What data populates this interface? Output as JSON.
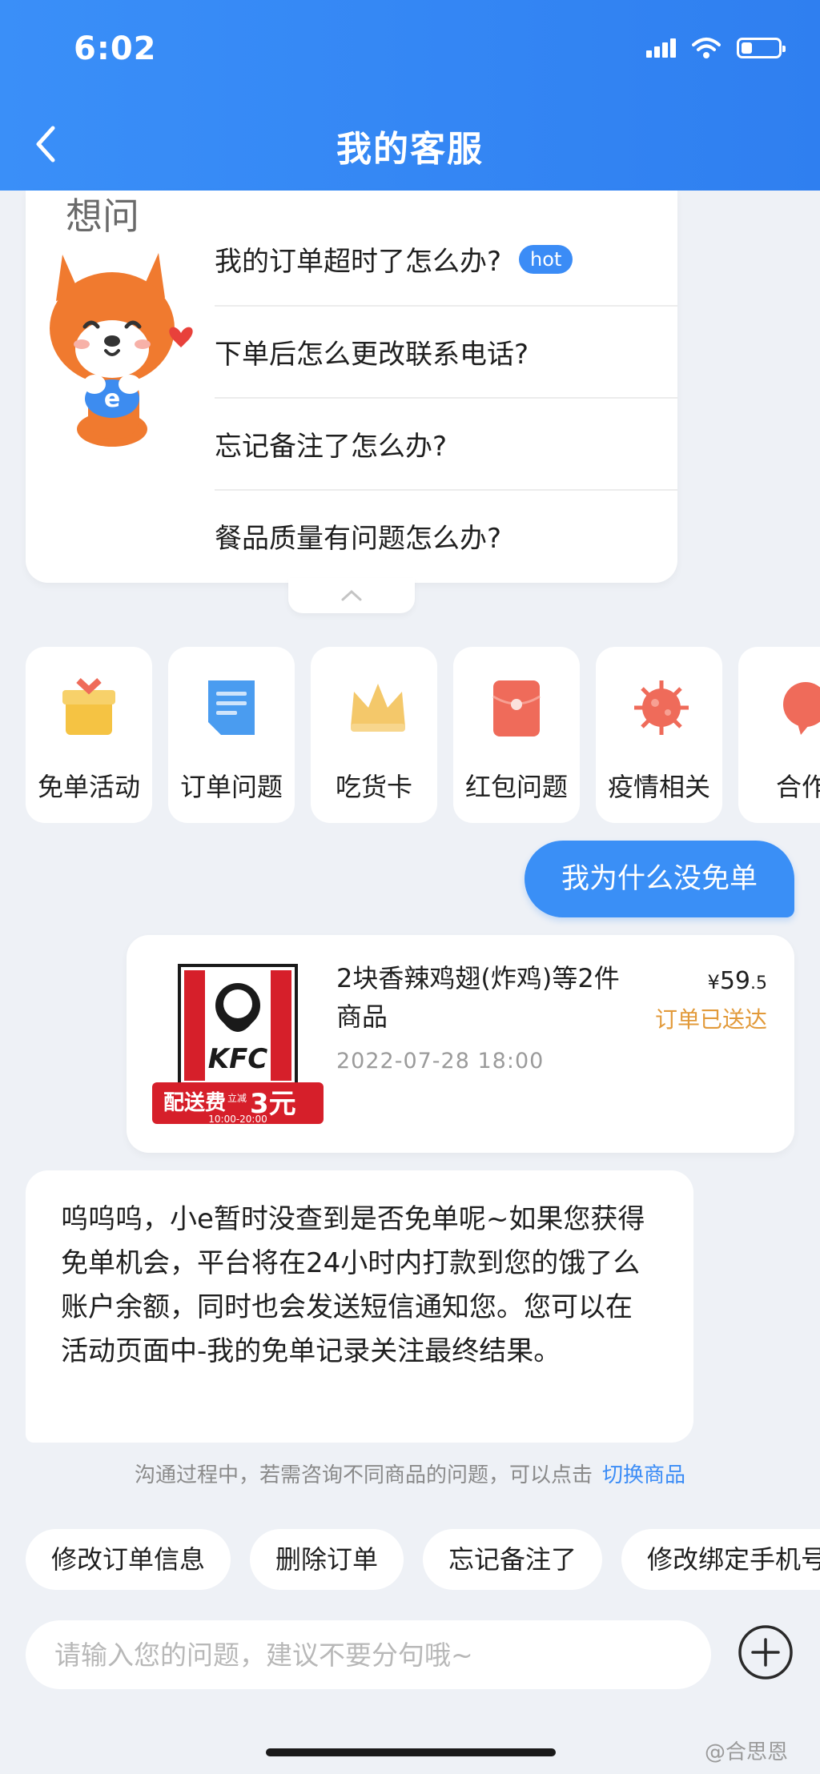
{
  "status_bar": {
    "time": "6:02",
    "battery_level": 0.3
  },
  "header": {
    "title": "我的客服"
  },
  "faq": {
    "heading": "想问",
    "questions": [
      {
        "text": "我的订单超时了怎么办?",
        "badge": "hot"
      },
      {
        "text": "下单后怎么更改联系电话?"
      },
      {
        "text": "忘记备注了怎么办?"
      },
      {
        "text": "餐品质量有问题怎么办?"
      }
    ]
  },
  "categories": [
    {
      "label": "免单活动",
      "icon": "gift-icon",
      "color": "#f5c343"
    },
    {
      "label": "订单问题",
      "icon": "document-icon",
      "color": "#4a9cf0"
    },
    {
      "label": "吃货卡",
      "icon": "crown-icon",
      "color": "#f4c86a"
    },
    {
      "label": "红包问题",
      "icon": "red-envelope-icon",
      "color": "#ef6b5a"
    },
    {
      "label": "疫情相关",
      "icon": "virus-icon",
      "color": "#ef6b5a"
    },
    {
      "label": "合作",
      "icon": "chat-bubble-icon",
      "color": "#ef6b5a"
    }
  ],
  "chat": {
    "user_message": "我为什么没免单",
    "order": {
      "title": "2块香辣鸡翅(炸鸡)等2件商品",
      "time": "2022-07-28 18:00",
      "price_currency": "¥",
      "price_int": "59",
      "price_dec": ".5",
      "status": "订单已送达",
      "logo_text": "KFC",
      "promo_text": "配送费",
      "promo_sub": "立减",
      "promo_amount": "3元",
      "promo_hours": "10:00-20:00"
    },
    "bot_message": "呜呜呜，小e暂时没查到是否免单呢~如果您获得免单机会，平台将在24小时内打款到您的饿了么账户余额，同时也会发送短信通知您。您可以在活动页面中-我的免单记录关注最终结果。"
  },
  "hint": {
    "text": "沟通过程中，若需咨询不同商品的问题，可以点击",
    "link": "切换商品"
  },
  "quick_replies": [
    "修改订单信息",
    "删除订单",
    "忘记备注了",
    "修改绑定手机号"
  ],
  "input": {
    "placeholder": "请输入您的问题，建议不要分句哦~"
  },
  "watermark": "@合思恩"
}
